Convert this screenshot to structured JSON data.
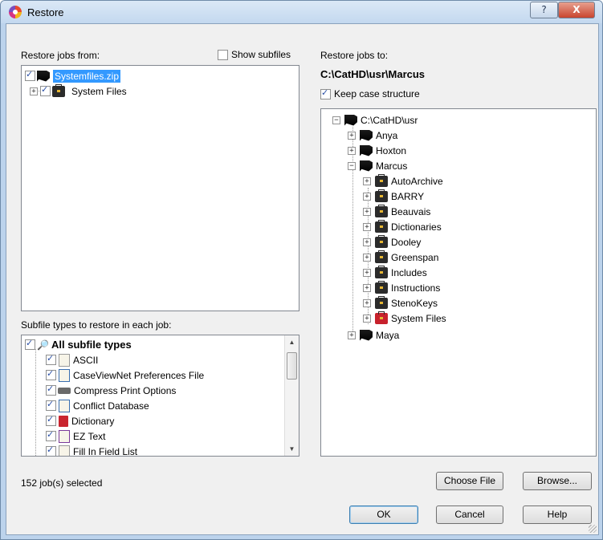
{
  "window": {
    "title": "Restore",
    "help_label": "?",
    "close_label": "X"
  },
  "left": {
    "restore_from_label": "Restore jobs from:",
    "show_subfiles_label": "Show subfiles",
    "show_subfiles_checked": false,
    "source_tree": [
      {
        "label": "Systemfiles.zip",
        "checked": true,
        "selected": true,
        "icon": "flag-icon"
      },
      {
        "label": "System Files",
        "checked": true,
        "selected": false,
        "icon": "briefcase-icon"
      }
    ],
    "subfile_types_label": "Subfile types to restore in each job:",
    "subfile_types": [
      {
        "label": "All subfile types",
        "checked": true,
        "bold": true
      },
      {
        "label": "ASCII",
        "checked": true
      },
      {
        "label": "CaseViewNet Preferences File",
        "checked": true
      },
      {
        "label": "Compress Print Options",
        "checked": true
      },
      {
        "label": "Conflict Database",
        "checked": true
      },
      {
        "label": "Dictionary",
        "checked": true
      },
      {
        "label": "EZ Text",
        "checked": true
      },
      {
        "label": "Fill In Field List",
        "checked": true
      }
    ],
    "status": "152 job(s) selected"
  },
  "right": {
    "restore_to_label": "Restore jobs to:",
    "restore_path": "C:\\CatHD\\usr\\Marcus",
    "keep_case_label": "Keep case structure",
    "keep_case_checked": true,
    "dest_tree": {
      "root": "C:\\CatHD\\usr",
      "users": [
        "Anya",
        "Hoxton",
        "Marcus"
      ],
      "marcus_children": [
        "AutoArchive",
        "BARRY",
        "Beauvais",
        "Dictionaries",
        "Dooley",
        "Greenspan",
        "Includes",
        "Instructions",
        "StenoKeys",
        "System Files"
      ],
      "last_user": "Maya"
    }
  },
  "buttons": {
    "choose_file": "Choose File",
    "browse": "Browse...",
    "ok": "OK",
    "cancel": "Cancel",
    "help": "Help"
  }
}
